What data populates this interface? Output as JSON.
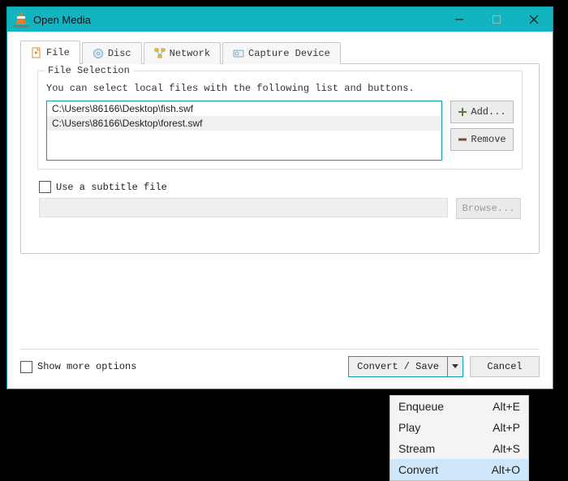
{
  "window": {
    "title": "Open Media"
  },
  "tabs": {
    "file": "File",
    "disc": "Disc",
    "network": "Network",
    "capture": "Capture Device"
  },
  "file_selection": {
    "legend": "File Selection",
    "description": "You can select local files with the following list and buttons.",
    "files": [
      "C:\\Users\\86166\\Desktop\\fish.swf",
      "C:\\Users\\86166\\Desktop\\forest.swf"
    ],
    "add_label": "Add...",
    "remove_label": "Remove"
  },
  "subtitle": {
    "checkbox_label": "Use a subtitle file",
    "browse_label": "Browse..."
  },
  "footer": {
    "show_more": "Show more options",
    "convert_save": "Convert / Save",
    "cancel": "Cancel"
  },
  "menu": {
    "items": [
      {
        "label": "Enqueue",
        "shortcut": "Alt+E"
      },
      {
        "label": "Play",
        "shortcut": "Alt+P"
      },
      {
        "label": "Stream",
        "shortcut": "Alt+S"
      },
      {
        "label": "Convert",
        "shortcut": "Alt+O"
      }
    ],
    "selected_index": 3
  }
}
